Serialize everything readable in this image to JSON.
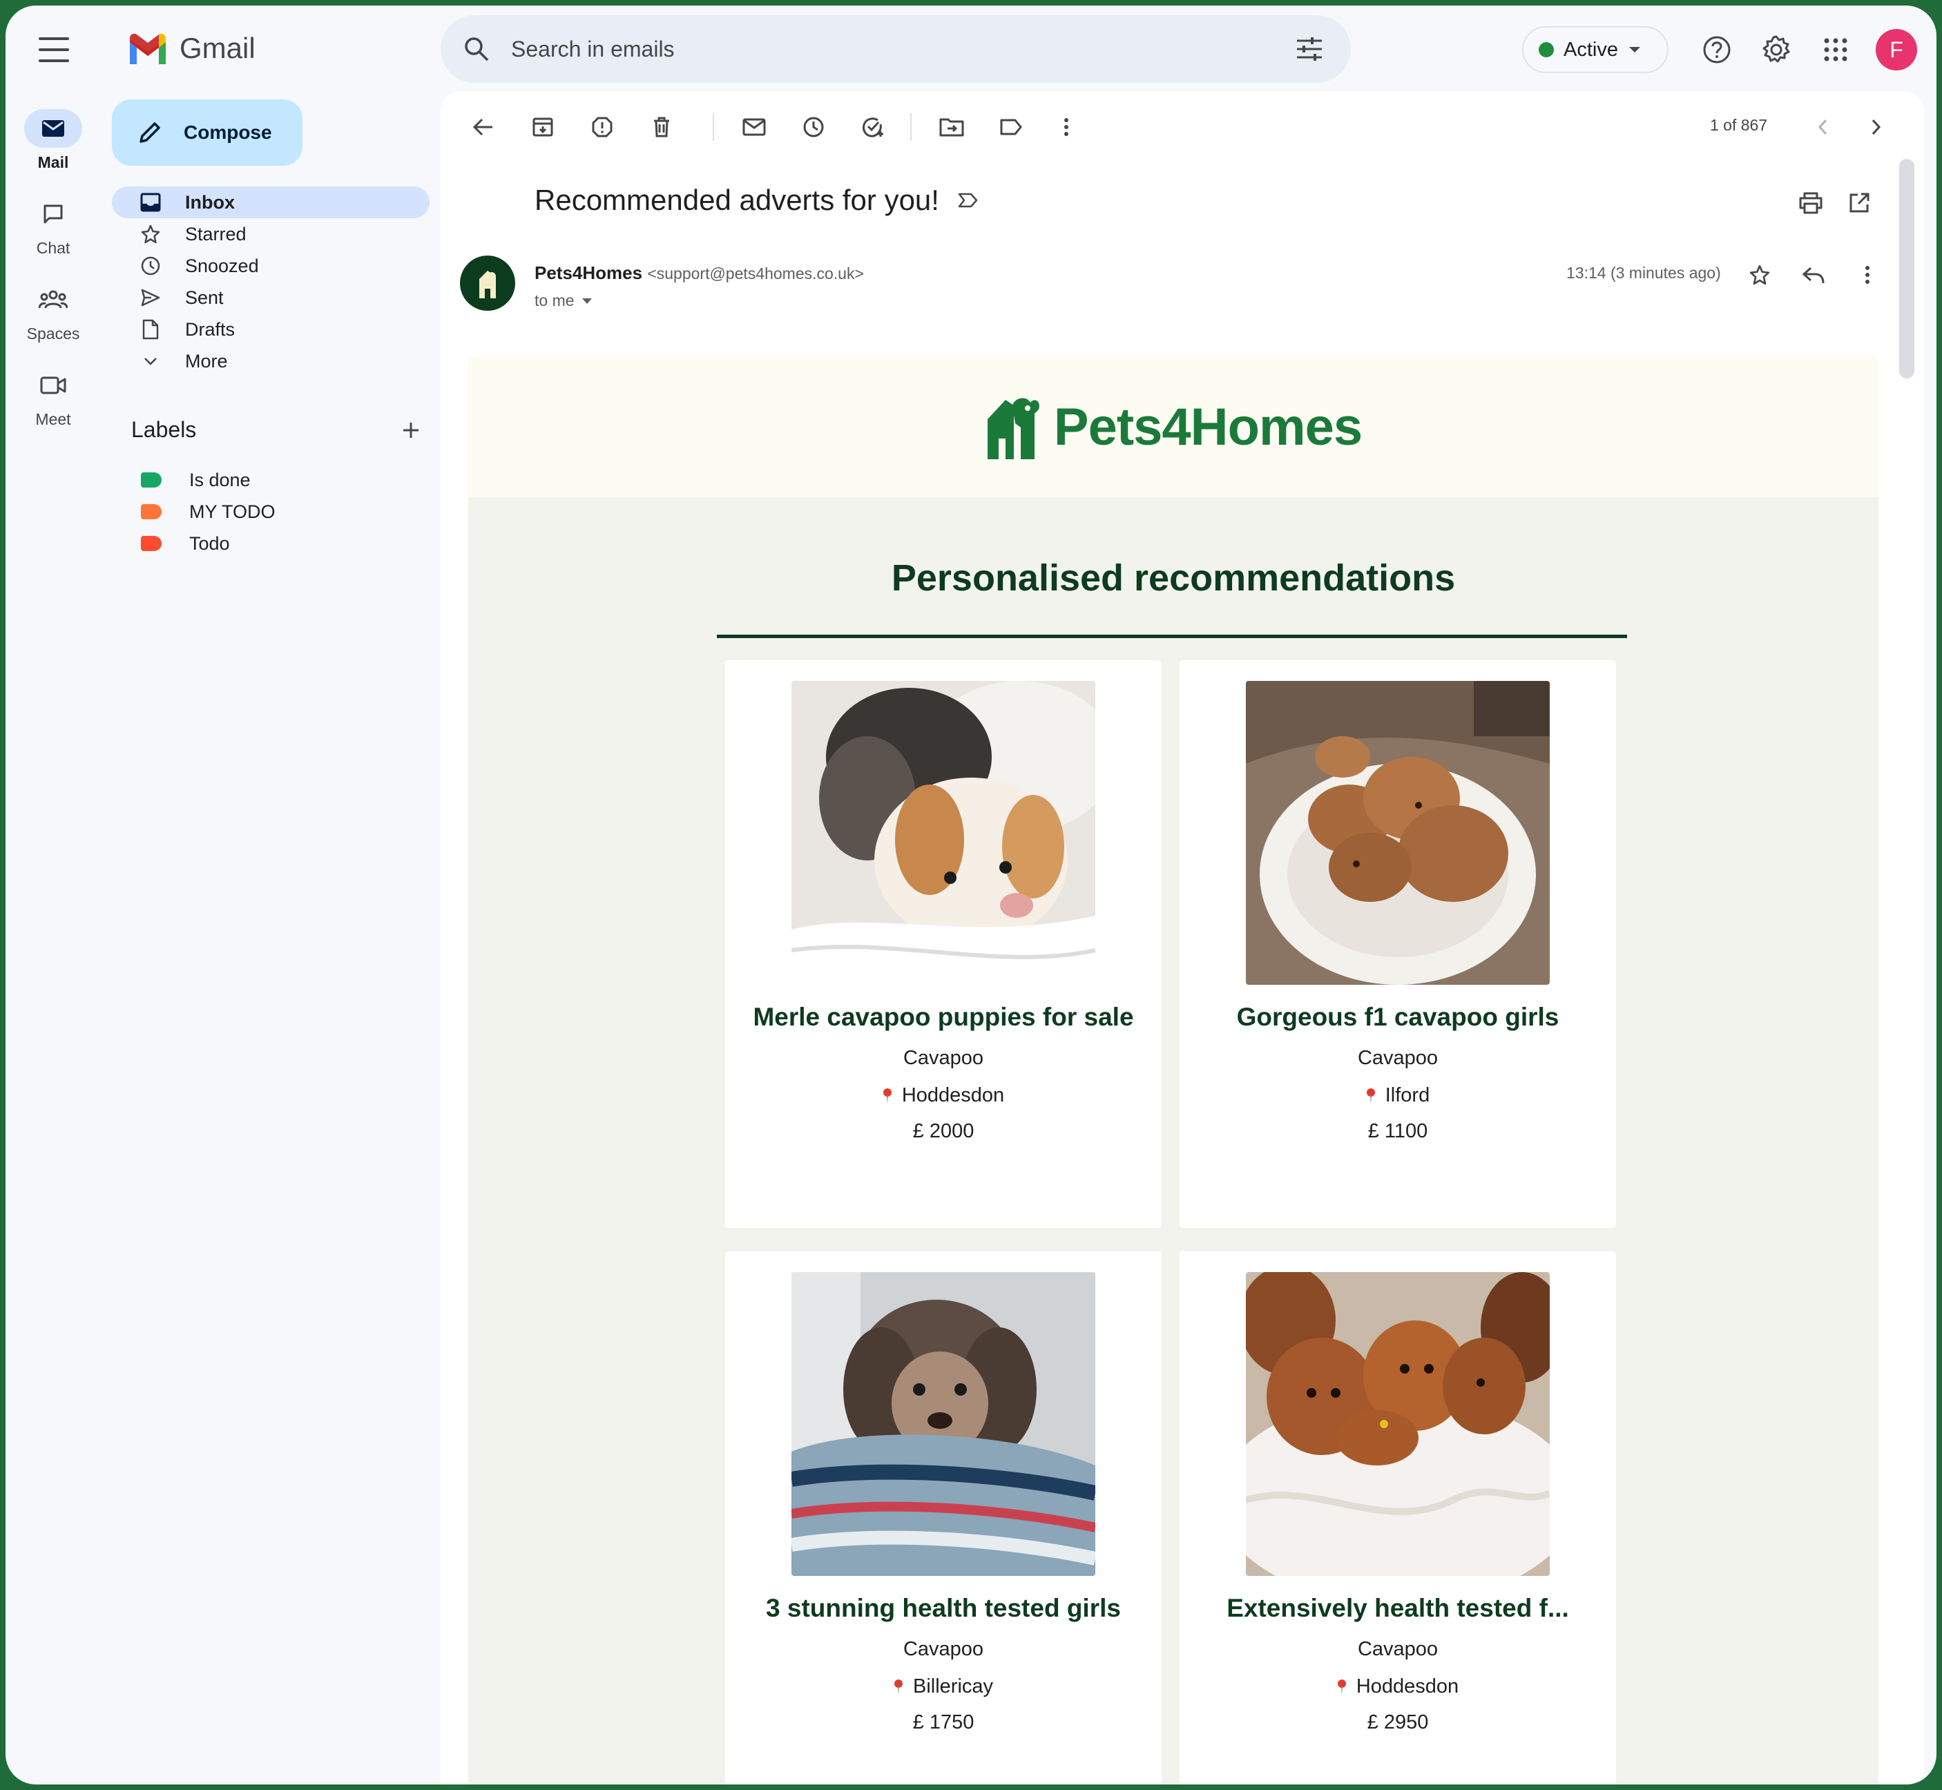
{
  "app": {
    "name": "Gmail"
  },
  "rail": [
    {
      "label": "Mail",
      "icon": "mail-icon",
      "active": true
    },
    {
      "label": "Chat",
      "icon": "chat-icon",
      "active": false
    },
    {
      "label": "Spaces",
      "icon": "spaces-icon",
      "active": false
    },
    {
      "label": "Meet",
      "icon": "meet-icon",
      "active": false
    }
  ],
  "compose": {
    "label": "Compose"
  },
  "nav": [
    {
      "label": "Inbox",
      "icon": "inbox-icon",
      "active": true
    },
    {
      "label": "Starred",
      "icon": "star-icon"
    },
    {
      "label": "Snoozed",
      "icon": "clock-icon"
    },
    {
      "label": "Sent",
      "icon": "send-icon"
    },
    {
      "label": "Drafts",
      "icon": "draft-icon"
    },
    {
      "label": "More",
      "icon": "chevron-down-icon"
    }
  ],
  "labels": {
    "title": "Labels",
    "items": [
      {
        "label": "Is done",
        "color": "#16a765"
      },
      {
        "label": "MY TODO",
        "color": "#ff7537"
      },
      {
        "label": "Todo",
        "color": "#fb4c2f"
      }
    ]
  },
  "search": {
    "placeholder": "Search in emails"
  },
  "status": {
    "label": "Active",
    "color": "#1e8e3e"
  },
  "account": {
    "initial": "F",
    "color": "#e8336d"
  },
  "pager": {
    "text": "1 of 867"
  },
  "message": {
    "subject": "Recommended adverts for you!",
    "sender_name": "Pets4Homes",
    "sender_email": "<support@pets4homes.co.uk>",
    "recipient": "to me",
    "timestamp": "13:14 (3 minutes ago)"
  },
  "email": {
    "brand": "Pets4Homes",
    "heading": "Personalised recommendations",
    "brand_color": "#1b7a3a",
    "listings": [
      {
        "title": "Merle cavapoo puppies for sale",
        "breed": "Cavapoo",
        "location": "Hoddesdon",
        "price": "£ 2000"
      },
      {
        "title": "Gorgeous f1 cavapoo girls",
        "breed": "Cavapoo",
        "location": "Ilford",
        "price": "£ 1100"
      },
      {
        "title": "3 stunning health tested girls",
        "breed": "Cavapoo",
        "location": "Billericay",
        "price": "£ 1750"
      },
      {
        "title": "Extensively health tested f...",
        "breed": "Cavapoo",
        "location": "Hoddesdon",
        "price": "£ 2950"
      }
    ]
  }
}
